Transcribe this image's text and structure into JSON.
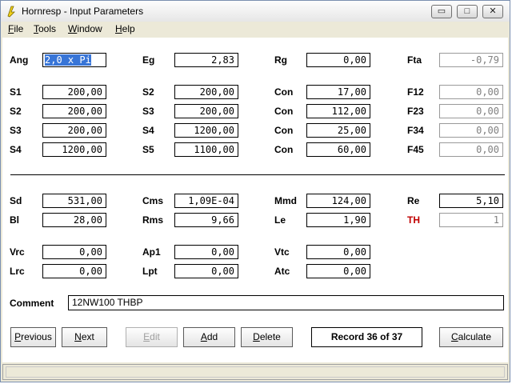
{
  "window": {
    "title": "Hornresp - Input Parameters",
    "controls": {
      "minimize": "▭",
      "maximize": "□",
      "close": "✕"
    }
  },
  "menu": [
    "File",
    "Tools",
    "Window",
    "Help"
  ],
  "params": {
    "ang": {
      "label": "Ang",
      "value": "2,0 x Pi"
    },
    "eg": {
      "label": "Eg",
      "value": "2,83"
    },
    "rg": {
      "label": "Rg",
      "value": "0,00"
    },
    "fta": {
      "label": "Fta",
      "value": "-0,79"
    },
    "s1": {
      "label": "S1",
      "value": "200,00"
    },
    "s2": {
      "label": "S2",
      "value": "200,00"
    },
    "s3": {
      "label": "S3",
      "value": "200,00"
    },
    "s4": {
      "label": "S4",
      "value": "1200,00"
    },
    "s2b": {
      "label": "S2",
      "value": "200,00"
    },
    "s3b": {
      "label": "S3",
      "value": "200,00"
    },
    "s4b": {
      "label": "S4",
      "value": "1200,00"
    },
    "s5": {
      "label": "S5",
      "value": "1100,00"
    },
    "con1": {
      "label": "Con",
      "value": "17,00"
    },
    "con2": {
      "label": "Con",
      "value": "112,00"
    },
    "con3": {
      "label": "Con",
      "value": "25,00"
    },
    "con4": {
      "label": "Con",
      "value": "60,00"
    },
    "f12": {
      "label": "F12",
      "value": "0,00"
    },
    "f23": {
      "label": "F23",
      "value": "0,00"
    },
    "f34": {
      "label": "F34",
      "value": "0,00"
    },
    "f45": {
      "label": "F45",
      "value": "0,00"
    },
    "sd": {
      "label": "Sd",
      "value": "531,00"
    },
    "bl": {
      "label": "Bl",
      "value": "28,00"
    },
    "cms": {
      "label": "Cms",
      "value": "1,09E-04"
    },
    "rms": {
      "label": "Rms",
      "value": "9,66"
    },
    "mmd": {
      "label": "Mmd",
      "value": "124,00"
    },
    "le": {
      "label": "Le",
      "value": "1,90"
    },
    "re": {
      "label": "Re",
      "value": "5,10"
    },
    "th": {
      "label": "TH",
      "value": "1"
    },
    "vrc": {
      "label": "Vrc",
      "value": "0,00"
    },
    "lrc": {
      "label": "Lrc",
      "value": "0,00"
    },
    "ap1": {
      "label": "Ap1",
      "value": "0,00"
    },
    "lpt": {
      "label": "Lpt",
      "value": "0,00"
    },
    "vtc": {
      "label": "Vtc",
      "value": "0,00"
    },
    "atc": {
      "label": "Atc",
      "value": "0,00"
    }
  },
  "comment": {
    "label": "Comment",
    "value": "12NW100 THBP"
  },
  "buttons": {
    "previous": "Previous",
    "next": "Next",
    "edit": "Edit",
    "add": "Add",
    "delete": "Delete",
    "calculate": "Calculate"
  },
  "record": "Record 36 of 37",
  "colors": {
    "th_label": "#c00000",
    "selection": "#3875d7"
  }
}
